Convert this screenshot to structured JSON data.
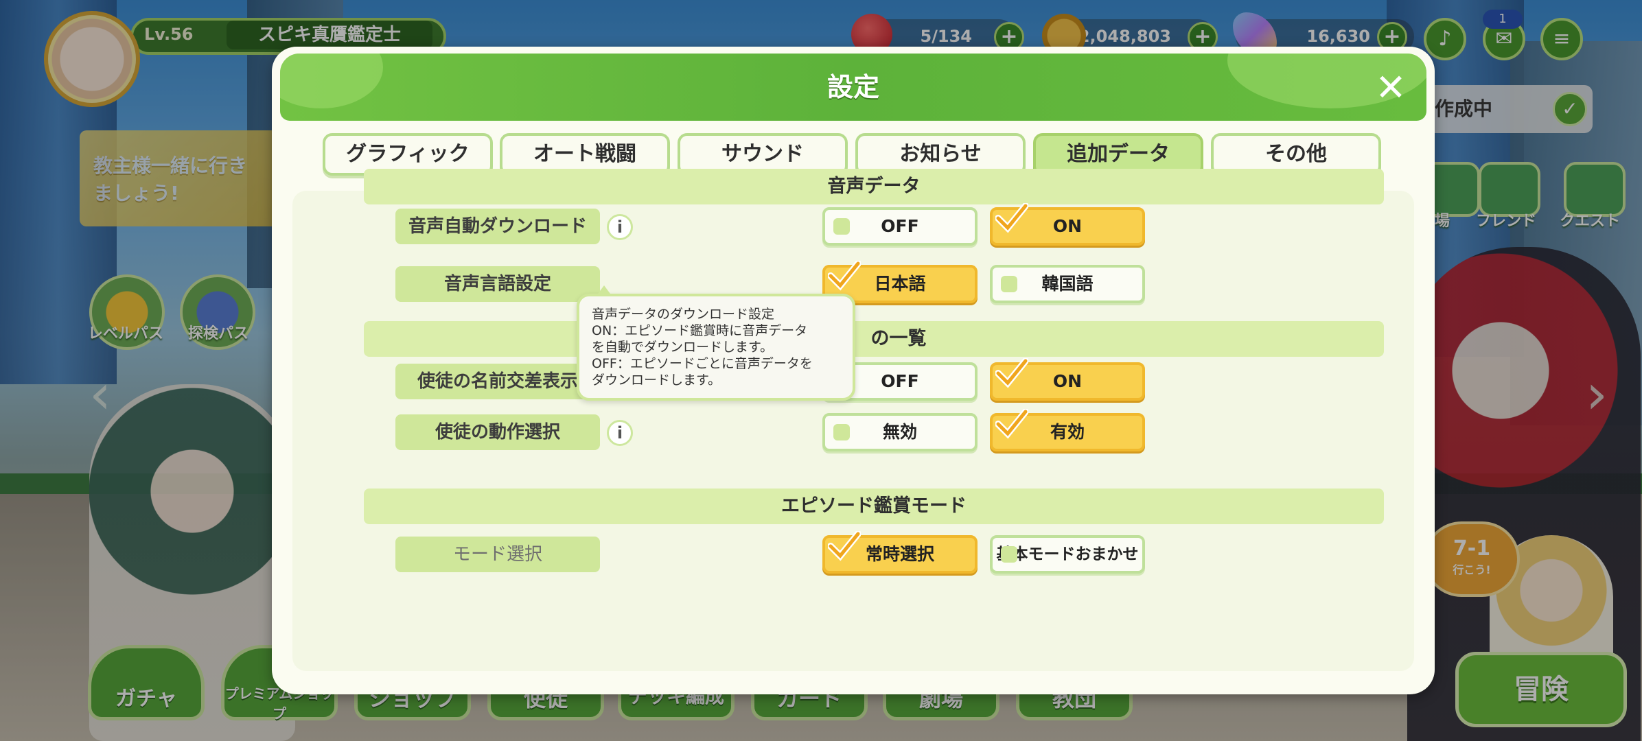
{
  "hud": {
    "level": "Lv.56",
    "title": "スピキ真贋鑑定士",
    "stamina": "5/134",
    "coins": "2,048,803",
    "gems": "16,630",
    "mail_badge": "1"
  },
  "background": {
    "banner_text": "教主様一緒に行きましょう!",
    "level_pass": "レベルパス",
    "explore_pass": "探検パス",
    "creating_label": "作成中",
    "side_item_partial": "場",
    "friend": "フレンド",
    "quest": "クエスト",
    "stage": "7-1",
    "stage_sub": "行こう!",
    "bottom_nav": [
      "ガチャ",
      "プレミアムショップ",
      "ショップ",
      "使徒",
      "デッキ編成",
      "カード",
      "劇場",
      "教団"
    ],
    "adventure": "冒険"
  },
  "dialog": {
    "title": "設定",
    "tabs": [
      {
        "label": "グラフィック",
        "active": false
      },
      {
        "label": "オート戦闘",
        "active": false
      },
      {
        "label": "サウンド",
        "active": false
      },
      {
        "label": "お知らせ",
        "active": false
      },
      {
        "label": "追加データ",
        "active": true
      },
      {
        "label": "その他",
        "active": false
      }
    ],
    "sections": {
      "voice_data": "音声データ",
      "list_partial": "の一覧",
      "episode_mode": "エピソード鑑賞モード"
    },
    "settings": {
      "auto_download": {
        "label": "音声自動ダウンロード",
        "off": "OFF",
        "on": "ON",
        "selected": "ON"
      },
      "language": {
        "label": "音声言語設定",
        "japanese": "日本語",
        "korean": "韓国語",
        "selected": "日本語"
      },
      "name_cross": {
        "label": "使徒の名前交差表示",
        "off": "OFF",
        "on": "ON",
        "selected": "ON"
      },
      "motion": {
        "label": "使徒の動作選択",
        "disabled": "無効",
        "enabled": "有効",
        "selected": "有効"
      },
      "mode": {
        "label": "モード選択",
        "always": "常時選択",
        "auto": "基本モードおまかせ",
        "selected": "常時選択"
      }
    },
    "tooltip": {
      "line1": "音声データのダウンロード設定",
      "line2": "ON：エピソード鑑賞時に音声データ",
      "line3": "を自動でダウンロードします。",
      "line4": "OFF：エピソードごとに音声データを",
      "line5": "ダウンロードします。"
    }
  },
  "colors": {
    "header_green": "#5db23a",
    "selected_yellow": "#f9d04e",
    "section_green": "#dbeeab",
    "panel_bg": "#f3f7e4"
  }
}
